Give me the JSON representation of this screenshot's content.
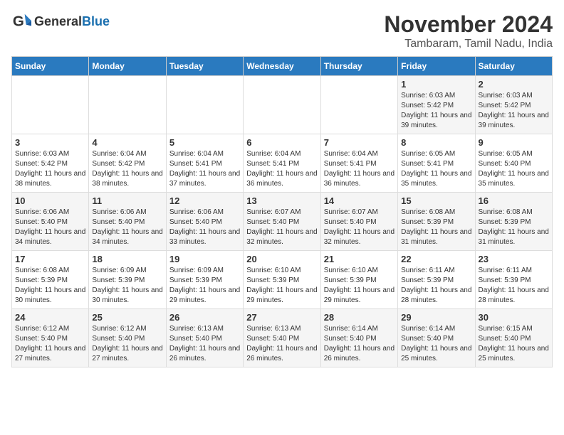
{
  "header": {
    "logo_general": "General",
    "logo_blue": "Blue",
    "month": "November 2024",
    "location": "Tambaram, Tamil Nadu, India"
  },
  "weekdays": [
    "Sunday",
    "Monday",
    "Tuesday",
    "Wednesday",
    "Thursday",
    "Friday",
    "Saturday"
  ],
  "weeks": [
    [
      {
        "day": "",
        "info": ""
      },
      {
        "day": "",
        "info": ""
      },
      {
        "day": "",
        "info": ""
      },
      {
        "day": "",
        "info": ""
      },
      {
        "day": "",
        "info": ""
      },
      {
        "day": "1",
        "info": "Sunrise: 6:03 AM\nSunset: 5:42 PM\nDaylight: 11 hours and 39 minutes."
      },
      {
        "day": "2",
        "info": "Sunrise: 6:03 AM\nSunset: 5:42 PM\nDaylight: 11 hours and 39 minutes."
      }
    ],
    [
      {
        "day": "3",
        "info": "Sunrise: 6:03 AM\nSunset: 5:42 PM\nDaylight: 11 hours and 38 minutes."
      },
      {
        "day": "4",
        "info": "Sunrise: 6:04 AM\nSunset: 5:42 PM\nDaylight: 11 hours and 38 minutes."
      },
      {
        "day": "5",
        "info": "Sunrise: 6:04 AM\nSunset: 5:41 PM\nDaylight: 11 hours and 37 minutes."
      },
      {
        "day": "6",
        "info": "Sunrise: 6:04 AM\nSunset: 5:41 PM\nDaylight: 11 hours and 36 minutes."
      },
      {
        "day": "7",
        "info": "Sunrise: 6:04 AM\nSunset: 5:41 PM\nDaylight: 11 hours and 36 minutes."
      },
      {
        "day": "8",
        "info": "Sunrise: 6:05 AM\nSunset: 5:41 PM\nDaylight: 11 hours and 35 minutes."
      },
      {
        "day": "9",
        "info": "Sunrise: 6:05 AM\nSunset: 5:40 PM\nDaylight: 11 hours and 35 minutes."
      }
    ],
    [
      {
        "day": "10",
        "info": "Sunrise: 6:06 AM\nSunset: 5:40 PM\nDaylight: 11 hours and 34 minutes."
      },
      {
        "day": "11",
        "info": "Sunrise: 6:06 AM\nSunset: 5:40 PM\nDaylight: 11 hours and 34 minutes."
      },
      {
        "day": "12",
        "info": "Sunrise: 6:06 AM\nSunset: 5:40 PM\nDaylight: 11 hours and 33 minutes."
      },
      {
        "day": "13",
        "info": "Sunrise: 6:07 AM\nSunset: 5:40 PM\nDaylight: 11 hours and 32 minutes."
      },
      {
        "day": "14",
        "info": "Sunrise: 6:07 AM\nSunset: 5:40 PM\nDaylight: 11 hours and 32 minutes."
      },
      {
        "day": "15",
        "info": "Sunrise: 6:08 AM\nSunset: 5:39 PM\nDaylight: 11 hours and 31 minutes."
      },
      {
        "day": "16",
        "info": "Sunrise: 6:08 AM\nSunset: 5:39 PM\nDaylight: 11 hours and 31 minutes."
      }
    ],
    [
      {
        "day": "17",
        "info": "Sunrise: 6:08 AM\nSunset: 5:39 PM\nDaylight: 11 hours and 30 minutes."
      },
      {
        "day": "18",
        "info": "Sunrise: 6:09 AM\nSunset: 5:39 PM\nDaylight: 11 hours and 30 minutes."
      },
      {
        "day": "19",
        "info": "Sunrise: 6:09 AM\nSunset: 5:39 PM\nDaylight: 11 hours and 29 minutes."
      },
      {
        "day": "20",
        "info": "Sunrise: 6:10 AM\nSunset: 5:39 PM\nDaylight: 11 hours and 29 minutes."
      },
      {
        "day": "21",
        "info": "Sunrise: 6:10 AM\nSunset: 5:39 PM\nDaylight: 11 hours and 29 minutes."
      },
      {
        "day": "22",
        "info": "Sunrise: 6:11 AM\nSunset: 5:39 PM\nDaylight: 11 hours and 28 minutes."
      },
      {
        "day": "23",
        "info": "Sunrise: 6:11 AM\nSunset: 5:39 PM\nDaylight: 11 hours and 28 minutes."
      }
    ],
    [
      {
        "day": "24",
        "info": "Sunrise: 6:12 AM\nSunset: 5:40 PM\nDaylight: 11 hours and 27 minutes."
      },
      {
        "day": "25",
        "info": "Sunrise: 6:12 AM\nSunset: 5:40 PM\nDaylight: 11 hours and 27 minutes."
      },
      {
        "day": "26",
        "info": "Sunrise: 6:13 AM\nSunset: 5:40 PM\nDaylight: 11 hours and 26 minutes."
      },
      {
        "day": "27",
        "info": "Sunrise: 6:13 AM\nSunset: 5:40 PM\nDaylight: 11 hours and 26 minutes."
      },
      {
        "day": "28",
        "info": "Sunrise: 6:14 AM\nSunset: 5:40 PM\nDaylight: 11 hours and 26 minutes."
      },
      {
        "day": "29",
        "info": "Sunrise: 6:14 AM\nSunset: 5:40 PM\nDaylight: 11 hours and 25 minutes."
      },
      {
        "day": "30",
        "info": "Sunrise: 6:15 AM\nSunset: 5:40 PM\nDaylight: 11 hours and 25 minutes."
      }
    ]
  ]
}
